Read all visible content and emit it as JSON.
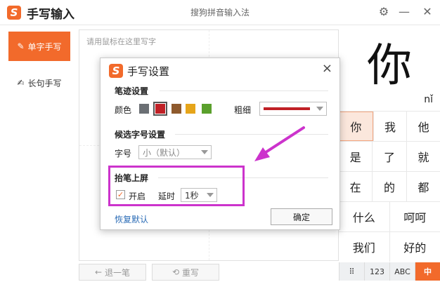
{
  "app": {
    "title": "手写输入",
    "caption": "搜狗拼音输入法",
    "logo_letter": "S",
    "accent": "#f26a2b",
    "icons": [
      "gear-icon",
      "minimize-icon",
      "close-icon"
    ]
  },
  "nav": {
    "items": [
      {
        "label": "单字手写",
        "icon": "pen-icon",
        "active": true
      },
      {
        "label": "长句手写",
        "icon": "brush-icon",
        "active": false
      }
    ]
  },
  "write_area": {
    "hint": "请用鼠标在这里写字",
    "undo_label": "退一笔",
    "rewrite_label": "重写"
  },
  "result": {
    "big_char": "你",
    "pinyin": "nǐ",
    "candidates": [
      [
        "你",
        "我",
        "他"
      ],
      [
        "是",
        "了",
        "就"
      ],
      [
        "在",
        "的",
        "都"
      ],
      [
        "什么",
        "呵呵"
      ],
      [
        "我们",
        "好的"
      ]
    ],
    "keyboard": [
      {
        "label": "⠿",
        "active": false
      },
      {
        "label": "123",
        "active": false
      },
      {
        "label": "ABC",
        "active": false
      },
      {
        "label": "中",
        "active": true
      }
    ]
  },
  "dialog": {
    "logo_letter": "S",
    "title": "手写设置",
    "close_glyph": "×",
    "stroke_section": "笔迹设置",
    "color_label": "颜色",
    "colors": [
      "#6b6f74",
      "#c02026",
      "#8e5a2d",
      "#e6a51a",
      "#5aa02c"
    ],
    "selected_color_index": 1,
    "thickness_label": "粗细",
    "thickness_color": "#c02026",
    "candidate_section": "候选字号设置",
    "font_size_label": "字号",
    "font_size_value": "小（默认）",
    "pen_up_section": "抬笔上屏",
    "enable_label": "开启",
    "enable_checked": true,
    "check_glyph": "✓",
    "delay_label": "延时",
    "delay_value": "1秒",
    "restore_label": "恢复默认",
    "ok_label": "确定"
  },
  "annotation": {
    "color": "#cc33cc"
  }
}
